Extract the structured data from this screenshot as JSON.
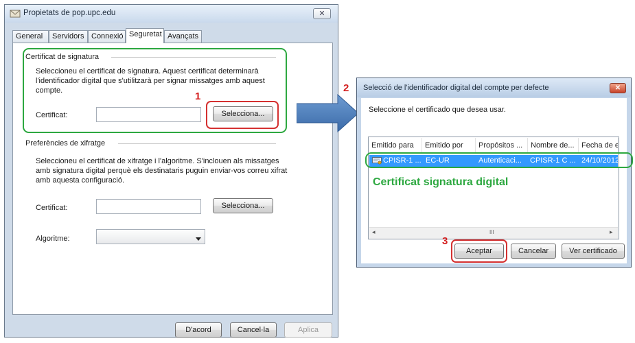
{
  "left_dialog": {
    "title": "Propietats de pop.upc.edu",
    "close_glyph": "✕",
    "tabs": [
      {
        "label": "General"
      },
      {
        "label": "Servidors"
      },
      {
        "label": "Connexió"
      },
      {
        "label": "Seguretat",
        "active": true
      },
      {
        "label": "Avançats"
      }
    ],
    "signing": {
      "group_label": "Certificat de signatura",
      "description": "Seleccioneu el certificat de signatura. Aquest certificat determinarà l'identificador digital que s'utilitzarà per signar missatges amb aquest compte.",
      "cert_label": "Certificat:",
      "cert_value": "",
      "select_button": "Selecciona..."
    },
    "encryption": {
      "group_label": "Preferències de xifratge",
      "description": "Seleccioneu el certificat de xifratge i l'algoritme. S'inclouen als missatges amb signatura digital perquè els destinataris puguin enviar-vos correu xifrat amb aquesta configuració.",
      "cert_label": "Certificat:",
      "cert_value": "",
      "select_button": "Selecciona...",
      "algorithm_label": "Algoritme:",
      "algorithm_value": ""
    },
    "footer": {
      "ok": "D'acord",
      "cancel": "Cancel·la",
      "apply": "Aplica"
    }
  },
  "right_dialog": {
    "title": "Selecció de l'identificador digital del compte per defecte",
    "close_glyph": "✕",
    "prompt": "Seleccione el certificado que desea usar.",
    "columns": [
      "Emitido para",
      "Emitido por",
      "Propósitos ...",
      "Nombre de...",
      "Fecha de e..."
    ],
    "rows": [
      [
        "CPISR-1 ...",
        "EC-UR",
        "Autenticaci...",
        "CPISR-1 C ...",
        "24/10/2012"
      ]
    ],
    "scroll_mid": "III",
    "scroll_left": "◂",
    "scroll_right": "▸",
    "buttons": {
      "accept": "Aceptar",
      "cancel": "Cancelar",
      "view": "Ver certificado"
    }
  },
  "annotations": {
    "step1": "1",
    "step2": "2",
    "step3": "3",
    "highlight_caption": "Certificat signatura digital",
    "green_color": "#2da840",
    "red_color": "#d43030",
    "arrow_color": "#4f81bd"
  }
}
